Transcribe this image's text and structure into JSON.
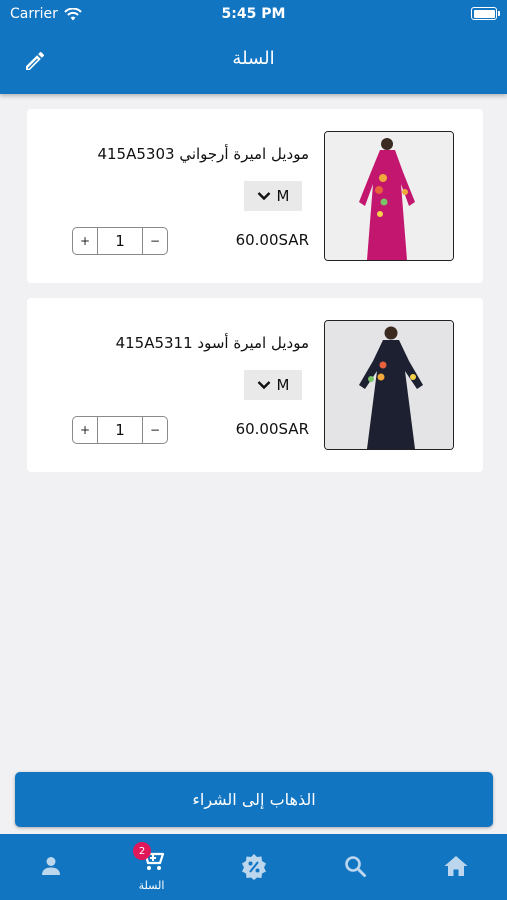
{
  "status_bar": {
    "carrier": "Carrier",
    "time": "5:45 PM"
  },
  "nav": {
    "title": "السلة",
    "edit_icon": "pencil-icon"
  },
  "cart_items": [
    {
      "name": "موديل اميرة أرجواني 415A5303",
      "size": "M",
      "price": "60.00SAR",
      "quantity": "1",
      "image_icon": "pink-dress-photo"
    },
    {
      "name": "موديل اميرة أسود 415A5311",
      "size": "M",
      "price": "60.00SAR",
      "quantity": "1",
      "image_icon": "black-dress-photo"
    }
  ],
  "stepper": {
    "plus": "+",
    "minus": "−"
  },
  "checkout": {
    "label": "الذهاب إلى الشراء"
  },
  "tabbar": {
    "items": [
      {
        "icon": "user-icon",
        "label": ""
      },
      {
        "icon": "cart-icon",
        "label": "السلة",
        "badge": "2",
        "active": true
      },
      {
        "icon": "discount-badge-icon",
        "label": ""
      },
      {
        "icon": "search-icon",
        "label": ""
      },
      {
        "icon": "home-icon",
        "label": ""
      }
    ]
  },
  "colors": {
    "primary": "#1275c2",
    "badge": "#e0185a",
    "background": "#f1f1f3"
  }
}
